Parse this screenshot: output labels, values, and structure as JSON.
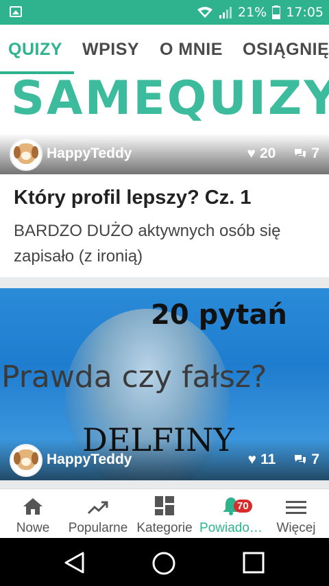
{
  "status_bar": {
    "battery": "21%",
    "time": "17:05",
    "background_color": "#2fb38f"
  },
  "tabs": [
    {
      "label": "QUIZY",
      "active": true
    },
    {
      "label": "WPISY",
      "active": false
    },
    {
      "label": "O MNIE",
      "active": false
    },
    {
      "label": "OSIĄGNIĘ",
      "active": false
    }
  ],
  "feed": [
    {
      "banner_text": "SAMEQUIZY",
      "author": "HappyTeddy",
      "likes": "20",
      "comments": "7",
      "title": "Który profil lepszy? Cz. 1",
      "description": "BARDZO DUŻO aktywnych osób się zapisało (z ironią)"
    },
    {
      "image_text_top": "20 pytań",
      "image_text_middle": "Prawda czy fałsz?",
      "image_text_bottom": "DELFINY",
      "author": "HappyTeddy",
      "likes": "11",
      "comments": "7"
    }
  ],
  "bottom_nav": [
    {
      "label": "Nowe",
      "icon": "home-icon"
    },
    {
      "label": "Popularne",
      "icon": "trending-icon"
    },
    {
      "label": "Kategorie",
      "icon": "grid-icon"
    },
    {
      "label": "Powiado…",
      "icon": "bell-icon",
      "badge": "70",
      "active": true
    },
    {
      "label": "Więcej",
      "icon": "menu-icon"
    }
  ],
  "accent_color": "#2fb38f",
  "badge_color": "#d92b2b"
}
